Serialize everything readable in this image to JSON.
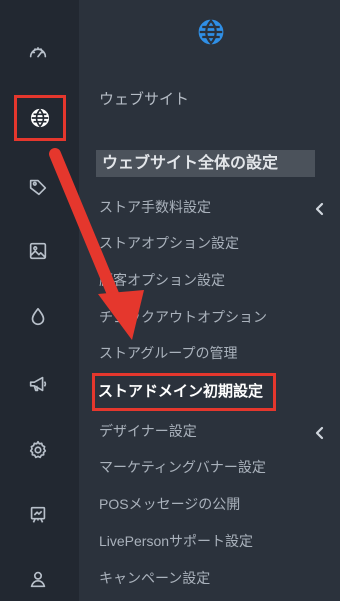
{
  "app": {
    "site_link": "ウェブサイト",
    "section_header": "ウェブサイト全体の設定"
  },
  "icons": {
    "rail": [
      "speedometer-icon",
      "globe-icon",
      "tag-icon",
      "image-icon",
      "droplet-icon",
      "megaphone-icon",
      "settings-icon",
      "presentation-icon",
      "user-icon"
    ],
    "top": "globe-icon",
    "chevrons": [
      "chevron-left-icon",
      "chevron-left-icon"
    ]
  },
  "menu": {
    "items": [
      "ストア手数料設定",
      "ストアオプション設定",
      "顧客オプション設定",
      "チェックアウトオプション",
      "ストアグループの管理",
      "ストアドメイン初期設定",
      "デザイナー設定",
      "マーケティングバナー設定",
      "POSメッセージの公開",
      "LivePersonサポート設定",
      "キャンペーン設定"
    ]
  },
  "colors": {
    "rail_bg": "#222831",
    "panel_bg": "#2b323c",
    "accent": "#2f8fe6",
    "annotation": "#e5372d",
    "text": "#aab2bc",
    "text_bright": "#ffffff"
  }
}
